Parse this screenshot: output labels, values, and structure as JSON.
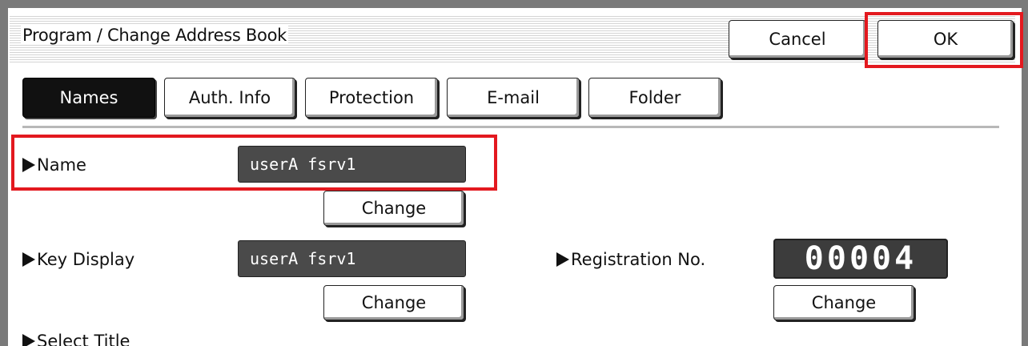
{
  "header": {
    "title": "Program / Change Address Book",
    "cancel_label": "Cancel",
    "ok_label": "OK"
  },
  "tabs": [
    {
      "label": "Names",
      "selected": true
    },
    {
      "label": "Auth. Info",
      "selected": false
    },
    {
      "label": "Protection",
      "selected": false
    },
    {
      "label": "E-mail",
      "selected": false
    },
    {
      "label": "Folder",
      "selected": false
    }
  ],
  "fields": {
    "name": {
      "label": "Name",
      "value": "userA fsrv1",
      "change_label": "Change"
    },
    "key_display": {
      "label": "Key Display",
      "value": "userA fsrv1",
      "change_label": "Change"
    },
    "registration_no": {
      "label": "Registration No.",
      "value": "00004",
      "change_label": "Change"
    },
    "select_title": {
      "label": "Select Title"
    }
  },
  "colors": {
    "highlight": "#e3191f",
    "selected_tab_bg": "#111111",
    "field_bg": "#4a4a4a"
  },
  "icons": {
    "field_marker": "right-triangle-icon"
  }
}
